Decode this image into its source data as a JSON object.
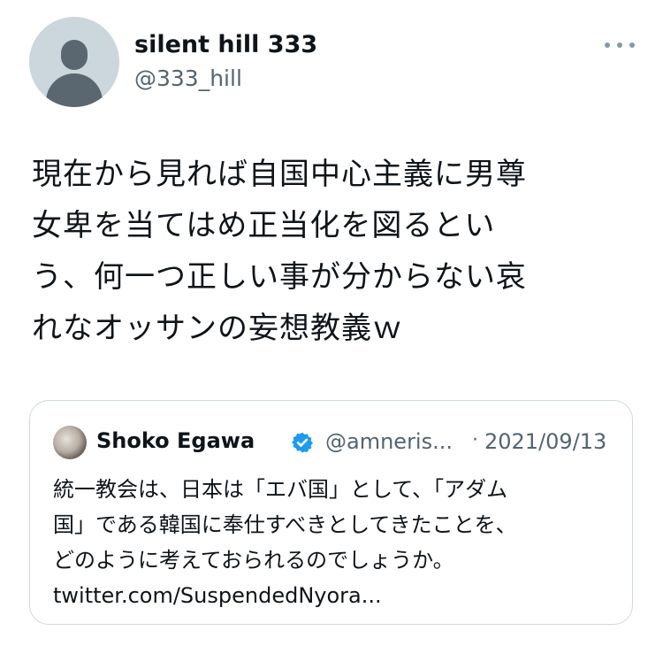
{
  "author": {
    "display_name": "silent hill 333",
    "handle": "@333_hill",
    "avatar_icon": "default-avatar-icon"
  },
  "menu": {
    "icon": "more-horizontal-icon"
  },
  "tweet": {
    "lines": [
      "現在から見れば自国中心主義に男尊",
      "女卑を当てはめ正当化を図るとい",
      "う、何一つ正しい事が分からない哀",
      "れなオッサンの妄想教義ｗ"
    ]
  },
  "quote": {
    "author_name": "Shoko Egawa",
    "verified_icon": "verified-badge-icon",
    "handle": "@amneris...",
    "separator": "·",
    "date": "2021/09/13",
    "lines": [
      "統一教会は、日本は「エバ国」として、「アダム",
      "国」である韓国に奉仕すべきとしてきたことを、",
      "どのように考えておられるのでしょうか。",
      "twitter.com/SuspendedNyora..."
    ]
  },
  "colors": {
    "text": "#0f1419",
    "secondary": "#536471",
    "border": "#cfd9de",
    "verified": "#1d9bf0",
    "avatar_bg": "#ccd6dd"
  }
}
